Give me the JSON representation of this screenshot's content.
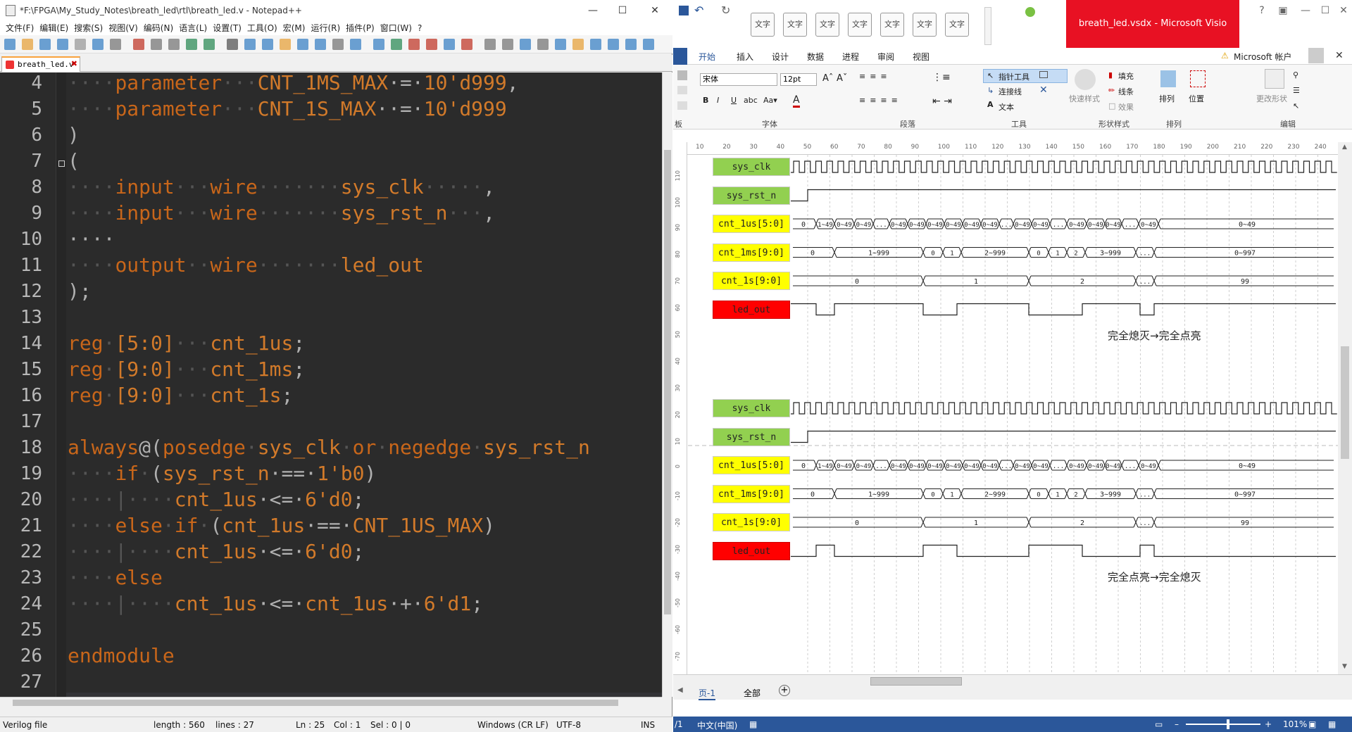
{
  "notepad": {
    "title": "*F:\\FPGA\\My_Study_Notes\\breath_led\\rtl\\breath_led.v - Notepad++",
    "menu": [
      "文件(F)",
      "编辑(E)",
      "搜索(S)",
      "视图(V)",
      "编码(N)",
      "语言(L)",
      "设置(T)",
      "工具(O)",
      "宏(M)",
      "运行(R)",
      "插件(P)",
      "窗口(W)",
      "?"
    ],
    "tab_label": "breath_led.v",
    "line_numbers": [
      "4",
      "5",
      "6",
      "7",
      "8",
      "9",
      "10",
      "11",
      "12",
      "13",
      "14",
      "15",
      "16",
      "17",
      "18",
      "19",
      "20",
      "21",
      "22",
      "23",
      "24",
      "25",
      "26",
      "27"
    ],
    "status": {
      "lang": "Verilog file",
      "length": "length : 560",
      "lines": "lines : 27",
      "ln": "Ln : 25",
      "col": "Col : 1",
      "sel": "Sel : 0 | 0",
      "eol": "Windows (CR LF)",
      "enc": "UTF-8",
      "ins": "INS"
    }
  },
  "code": {
    "l4": [
      "····",
      "parameter",
      "···",
      "CNT_1MS_MAX",
      "·=·",
      "10'd999",
      ","
    ],
    "l5": [
      "····",
      "parameter",
      "···",
      "CNT_1S_MAX",
      "··=·",
      "10'd999"
    ],
    "l6": ")",
    "l7": "(",
    "l8": [
      "····",
      "input",
      "···",
      "wire",
      "·······",
      "sys_clk",
      "·····",
      ","
    ],
    "l9": [
      "····",
      "input",
      "···",
      "wire",
      "·······",
      "sys_rst_n",
      "···",
      ","
    ],
    "l10": "····",
    "l11": [
      "····",
      "output",
      "··",
      "wire",
      "·······",
      "led_out"
    ],
    "l12": ");",
    "l14": [
      "reg",
      "·",
      "[5:0]",
      "···",
      "cnt_1us",
      ";"
    ],
    "l15": [
      "reg",
      "·",
      "[9:0]",
      "···",
      "cnt_1ms",
      ";"
    ],
    "l16": [
      "reg",
      "·",
      "[9:0]",
      "···",
      "cnt_1s",
      ";"
    ],
    "l18": [
      "always",
      "@",
      "(",
      "posedge",
      "·",
      "sys_clk",
      "·",
      "or",
      "·",
      "negedge",
      "·",
      "sys_rst_n"
    ],
    "l19": [
      "····",
      "if",
      "·",
      "(",
      "sys_rst_n",
      "·==·",
      "1'b0",
      ")"
    ],
    "l20": [
      "····|····",
      "cnt_1us",
      "·<=·",
      "6'd0",
      ";"
    ],
    "l21": [
      "····",
      "else",
      "·",
      "if",
      "·",
      "(",
      "cnt_1us",
      "·==·",
      "CNT_1US_MAX",
      ")"
    ],
    "l22": [
      "····|····",
      "cnt_1us",
      "·<=·",
      "6'd0",
      ";"
    ],
    "l23": [
      "····",
      "else"
    ],
    "l24": [
      "····|····",
      "cnt_1us",
      "·<=·",
      "cnt_1us",
      "·+·",
      "6'd1",
      ";"
    ],
    "l26": "endmodule"
  },
  "visio": {
    "title": "breath_led.vsdx  -  Microsoft Visio",
    "quick_style": "文字",
    "tabs": [
      "开始",
      "插入",
      "设计",
      "数据",
      "进程",
      "审阅",
      "视图"
    ],
    "account": "Microsoft 帐户",
    "ribbon": {
      "font": "宋体",
      "size": "12pt",
      "groups": [
        "板",
        "字体",
        "段落",
        "工具",
        "形状样式",
        "排列",
        "编辑"
      ],
      "tools": [
        "指针工具",
        "连接线",
        "文本"
      ],
      "shape": [
        "填充",
        "线条",
        "效果"
      ],
      "quick_styles": "快速样式",
      "arrange": [
        "排列",
        "位置"
      ],
      "edit": "更改形状"
    },
    "top_ruler": [
      "10",
      "20",
      "30",
      "40",
      "50",
      "60",
      "70",
      "80",
      "90",
      "100",
      "110",
      "120",
      "130",
      "140",
      "150",
      "160",
      "170",
      "180",
      "190",
      "200",
      "210",
      "220",
      "230",
      "240"
    ],
    "left_ruler": [
      "110",
      "100",
      "90",
      "80",
      "70",
      "60",
      "50",
      "40",
      "30",
      "20",
      "10",
      "0",
      "-10",
      "-20",
      "-30",
      "-40",
      "-50",
      "-60",
      "-70"
    ],
    "page_tab": "页-1",
    "page_all": "全部",
    "status": {
      "lang": "中文(中国)",
      "zoom": "101%"
    }
  },
  "waveforms": [
    {
      "signals": [
        {
          "name": "sys_clk",
          "color": "#92d050"
        },
        {
          "name": "sys_rst_n",
          "color": "#92d050"
        },
        {
          "name": "cnt_1us[5:0]",
          "color": "#ffff00"
        },
        {
          "name": "cnt_1ms[9:0]",
          "color": "#ffff00"
        },
        {
          "name": "cnt_1s[9:0]",
          "color": "#ffff00"
        },
        {
          "name": "led_out",
          "color": "#ff0000"
        }
      ],
      "caption": "完全熄灭→完全点亮",
      "led_pattern": "low_high"
    },
    {
      "signals": [
        {
          "name": "sys_clk",
          "color": "#92d050"
        },
        {
          "name": "sys_rst_n",
          "color": "#92d050"
        },
        {
          "name": "cnt_1us[5:0]",
          "color": "#ffff00"
        },
        {
          "name": "cnt_1ms[9:0]",
          "color": "#ffff00"
        },
        {
          "name": "cnt_1s[9:0]",
          "color": "#ffff00"
        },
        {
          "name": "led_out",
          "color": "#ff0000"
        }
      ],
      "caption": "完全点亮→完全熄灭",
      "led_pattern": "high_low"
    }
  ],
  "bus_values": {
    "us": [
      "0",
      "1~49",
      "0~49",
      "0~49",
      "...",
      "0~49",
      "0~49",
      "0~49",
      "0~49",
      "0~49",
      "0~49",
      "...",
      "0~49",
      "0~49",
      "...",
      "0~49",
      "0~49",
      "0~49",
      "...",
      "0~49",
      "0~49"
    ],
    "ms": [
      "0",
      "1~999",
      "0",
      "1",
      "2~999",
      "0",
      "1",
      "2",
      "3~999",
      "...",
      "0~997"
    ],
    "s": [
      "0",
      "1",
      "2",
      "...",
      "99"
    ]
  }
}
